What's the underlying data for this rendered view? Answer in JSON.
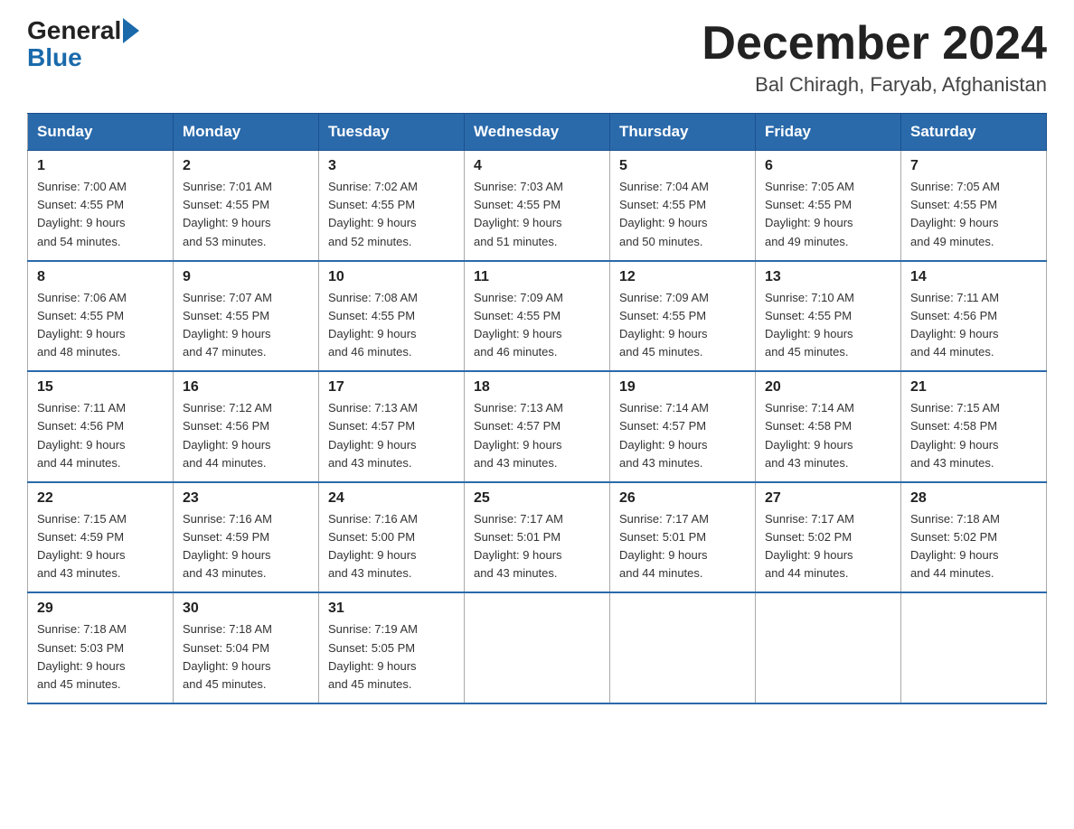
{
  "logo": {
    "general": "General",
    "blue": "Blue"
  },
  "title": "December 2024",
  "subtitle": "Bal Chiragh, Faryab, Afghanistan",
  "days": [
    "Sunday",
    "Monday",
    "Tuesday",
    "Wednesday",
    "Thursday",
    "Friday",
    "Saturday"
  ],
  "weeks": [
    [
      {
        "day": "1",
        "sunrise": "7:00 AM",
        "sunset": "4:55 PM",
        "daylight": "9 hours and 54 minutes."
      },
      {
        "day": "2",
        "sunrise": "7:01 AM",
        "sunset": "4:55 PM",
        "daylight": "9 hours and 53 minutes."
      },
      {
        "day": "3",
        "sunrise": "7:02 AM",
        "sunset": "4:55 PM",
        "daylight": "9 hours and 52 minutes."
      },
      {
        "day": "4",
        "sunrise": "7:03 AM",
        "sunset": "4:55 PM",
        "daylight": "9 hours and 51 minutes."
      },
      {
        "day": "5",
        "sunrise": "7:04 AM",
        "sunset": "4:55 PM",
        "daylight": "9 hours and 50 minutes."
      },
      {
        "day": "6",
        "sunrise": "7:05 AM",
        "sunset": "4:55 PM",
        "daylight": "9 hours and 49 minutes."
      },
      {
        "day": "7",
        "sunrise": "7:05 AM",
        "sunset": "4:55 PM",
        "daylight": "9 hours and 49 minutes."
      }
    ],
    [
      {
        "day": "8",
        "sunrise": "7:06 AM",
        "sunset": "4:55 PM",
        "daylight": "9 hours and 48 minutes."
      },
      {
        "day": "9",
        "sunrise": "7:07 AM",
        "sunset": "4:55 PM",
        "daylight": "9 hours and 47 minutes."
      },
      {
        "day": "10",
        "sunrise": "7:08 AM",
        "sunset": "4:55 PM",
        "daylight": "9 hours and 46 minutes."
      },
      {
        "day": "11",
        "sunrise": "7:09 AM",
        "sunset": "4:55 PM",
        "daylight": "9 hours and 46 minutes."
      },
      {
        "day": "12",
        "sunrise": "7:09 AM",
        "sunset": "4:55 PM",
        "daylight": "9 hours and 45 minutes."
      },
      {
        "day": "13",
        "sunrise": "7:10 AM",
        "sunset": "4:55 PM",
        "daylight": "9 hours and 45 minutes."
      },
      {
        "day": "14",
        "sunrise": "7:11 AM",
        "sunset": "4:56 PM",
        "daylight": "9 hours and 44 minutes."
      }
    ],
    [
      {
        "day": "15",
        "sunrise": "7:11 AM",
        "sunset": "4:56 PM",
        "daylight": "9 hours and 44 minutes."
      },
      {
        "day": "16",
        "sunrise": "7:12 AM",
        "sunset": "4:56 PM",
        "daylight": "9 hours and 44 minutes."
      },
      {
        "day": "17",
        "sunrise": "7:13 AM",
        "sunset": "4:57 PM",
        "daylight": "9 hours and 43 minutes."
      },
      {
        "day": "18",
        "sunrise": "7:13 AM",
        "sunset": "4:57 PM",
        "daylight": "9 hours and 43 minutes."
      },
      {
        "day": "19",
        "sunrise": "7:14 AM",
        "sunset": "4:57 PM",
        "daylight": "9 hours and 43 minutes."
      },
      {
        "day": "20",
        "sunrise": "7:14 AM",
        "sunset": "4:58 PM",
        "daylight": "9 hours and 43 minutes."
      },
      {
        "day": "21",
        "sunrise": "7:15 AM",
        "sunset": "4:58 PM",
        "daylight": "9 hours and 43 minutes."
      }
    ],
    [
      {
        "day": "22",
        "sunrise": "7:15 AM",
        "sunset": "4:59 PM",
        "daylight": "9 hours and 43 minutes."
      },
      {
        "day": "23",
        "sunrise": "7:16 AM",
        "sunset": "4:59 PM",
        "daylight": "9 hours and 43 minutes."
      },
      {
        "day": "24",
        "sunrise": "7:16 AM",
        "sunset": "5:00 PM",
        "daylight": "9 hours and 43 minutes."
      },
      {
        "day": "25",
        "sunrise": "7:17 AM",
        "sunset": "5:01 PM",
        "daylight": "9 hours and 43 minutes."
      },
      {
        "day": "26",
        "sunrise": "7:17 AM",
        "sunset": "5:01 PM",
        "daylight": "9 hours and 44 minutes."
      },
      {
        "day": "27",
        "sunrise": "7:17 AM",
        "sunset": "5:02 PM",
        "daylight": "9 hours and 44 minutes."
      },
      {
        "day": "28",
        "sunrise": "7:18 AM",
        "sunset": "5:02 PM",
        "daylight": "9 hours and 44 minutes."
      }
    ],
    [
      {
        "day": "29",
        "sunrise": "7:18 AM",
        "sunset": "5:03 PM",
        "daylight": "9 hours and 45 minutes."
      },
      {
        "day": "30",
        "sunrise": "7:18 AM",
        "sunset": "5:04 PM",
        "daylight": "9 hours and 45 minutes."
      },
      {
        "day": "31",
        "sunrise": "7:19 AM",
        "sunset": "5:05 PM",
        "daylight": "9 hours and 45 minutes."
      },
      null,
      null,
      null,
      null
    ]
  ],
  "labels": {
    "sunrise": "Sunrise:",
    "sunset": "Sunset:",
    "daylight": "Daylight:"
  }
}
